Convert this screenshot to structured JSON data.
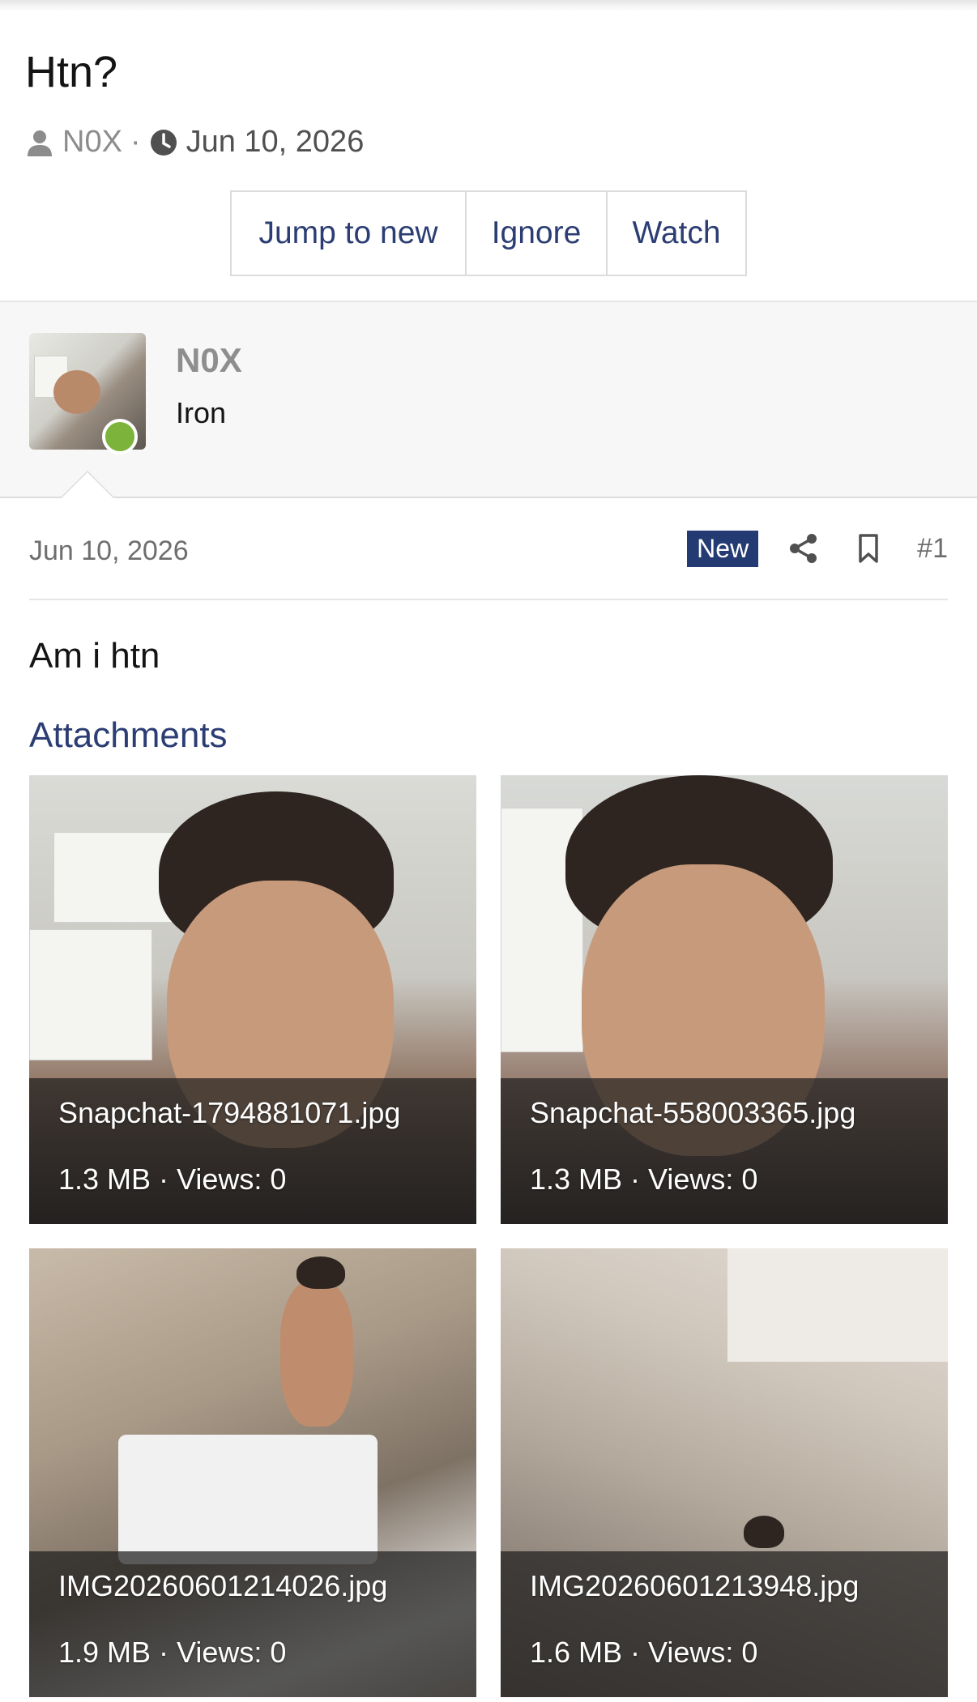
{
  "thread": {
    "title": "Htn?",
    "author": "N0X",
    "separator": "·",
    "date": "Jun 10, 2026",
    "actions": {
      "jump": "Jump to new",
      "ignore": "Ignore",
      "watch": "Watch"
    }
  },
  "user": {
    "name": "N0X",
    "rank": "Iron",
    "online": true,
    "online_color": "#7cb33a"
  },
  "post": {
    "date": "Jun 10, 2026",
    "badge": "New",
    "badge_color": "#243a73",
    "number": "#1",
    "body": "Am i htn",
    "attachments_title": "Attachments",
    "attachments": [
      {
        "name": "Snapchat-1794881071.jpg",
        "meta": "1.3 MB · Views: 0"
      },
      {
        "name": "Snapchat-558003365.jpg",
        "meta": "1.3 MB · Views: 0"
      },
      {
        "name": "IMG20260601214026.jpg",
        "meta": "1.9 MB · Views: 0"
      },
      {
        "name": "IMG20260601213948.jpg",
        "meta": "1.6 MB · Views: 0"
      }
    ]
  },
  "icons": {
    "user": "user-icon",
    "clock": "clock-icon",
    "share": "share-icon",
    "bookmark": "bookmark-icon"
  },
  "colors": {
    "link": "#2b3d73",
    "muted": "#8c8c8c"
  }
}
